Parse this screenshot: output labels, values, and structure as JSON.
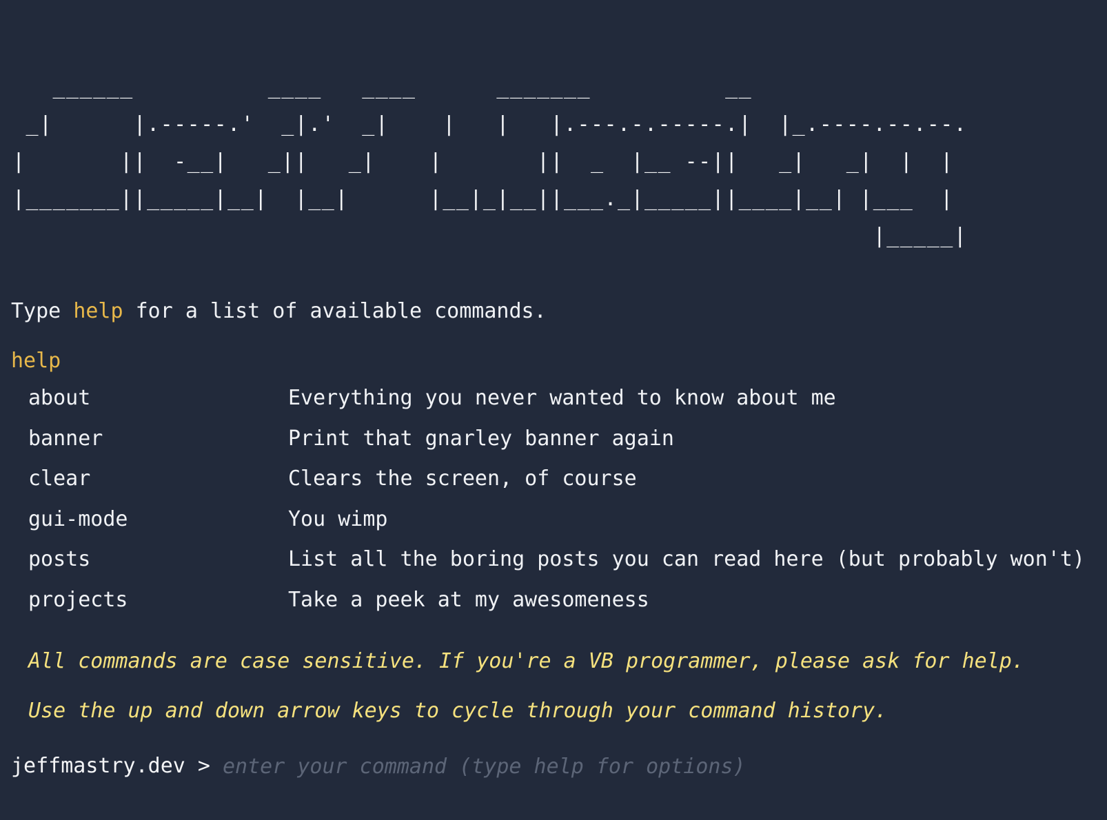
{
  "banner": {
    "ascii": "   ______          ____   ____      _______          __\n _|      |.-----.'  _|.'  _|    |   |   |.---.-.-----.|  |_.----.--.--.\n|       ||  -__|   _||   _|    |       ||  _  |__ --||   _|   _|  |  |\n|_______||_____|__|  |__|      |__|_|__||___._|_____||____|__| |___  |\n                                                                |_____|"
  },
  "intro": {
    "before": "Type ",
    "keyword": "help",
    "after": " for a list of available commands."
  },
  "echo": "help",
  "commands": [
    {
      "name": "about",
      "desc": "Everything you never wanted to know about me"
    },
    {
      "name": "banner",
      "desc": "Print that gnarley banner again"
    },
    {
      "name": "clear",
      "desc": "Clears the screen, of course"
    },
    {
      "name": "gui-mode",
      "desc": "You wimp"
    },
    {
      "name": "posts",
      "desc": "List all the boring posts you can read here (but probably won't)"
    },
    {
      "name": "projects",
      "desc": "Take a peek at my awesomeness"
    }
  ],
  "notes": {
    "case": "All commands are case sensitive. If you're a VB programmer, please ask for help.",
    "history": "Use the up and down arrow keys to cycle through your command history."
  },
  "prompt": {
    "label": "jeffmastry.dev >",
    "value": "",
    "placeholder": "enter your command (type help for options)"
  },
  "colors": {
    "background": "#222a3b",
    "text": "#f0f2f5",
    "keyword": "#e8b84a",
    "note": "#f5e17e",
    "placeholder": "#5c6577"
  }
}
